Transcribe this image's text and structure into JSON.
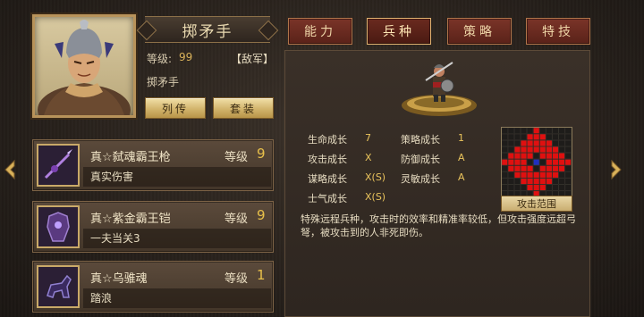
{
  "hero": {
    "name": "掷矛手",
    "level_label": "等级:",
    "level_value": "99",
    "faction": "【敌军】",
    "unit_type": "掷矛手",
    "btn_bio": "列传",
    "btn_set": "套装"
  },
  "equipment": [
    {
      "name": "真☆弑魂霸王枪",
      "level_label": "等级",
      "level": "9",
      "desc": "真实伤害",
      "icon": "spear-icon"
    },
    {
      "name": "真☆紫金霸王铠",
      "level_label": "等级",
      "level": "9",
      "desc": "一夫当关3",
      "icon": "armor-icon"
    },
    {
      "name": "真☆乌骓魂",
      "level_label": "等级",
      "level": "1",
      "desc": "踏浪",
      "icon": "horse-icon"
    }
  ],
  "tabs": [
    "能力",
    "兵种",
    "策略",
    "特技"
  ],
  "active_tab": 1,
  "growth": {
    "hp_label": "生命成长",
    "hp": "7",
    "strategy_label": "策略成长",
    "strategy": "1",
    "atk_label": "攻击成长",
    "atk": "X",
    "def_label": "防御成长",
    "def": "A",
    "int_label": "谋略成长",
    "int": "X(S)",
    "agi_label": "灵敏成长",
    "agi": "A",
    "morale_label": "士气成长",
    "morale": "X(S)"
  },
  "attack_range_label": "攻击范围",
  "description": "特殊远程兵种，攻击时的效率和精准率较低，但攻击强度远超弓弩，被攻击到的人非死即伤。",
  "colors": {
    "accent_gold": "#e8c04a",
    "tab_red": "#6a2a1f",
    "range_red": "#e01010",
    "range_blue": "#2030c0"
  }
}
